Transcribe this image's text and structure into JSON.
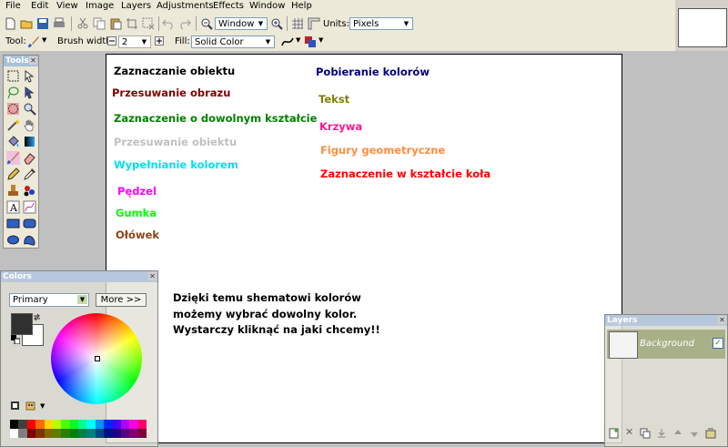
{
  "menu": [
    "File",
    "Edit",
    "View",
    "Image",
    "Layers",
    "Adjustments",
    "Effects",
    "Window",
    "Help"
  ],
  "toolbar": {
    "zoom_value": "Window",
    "units_label": "Units:",
    "units_value": "Pixels",
    "tool_label": "Tool:",
    "brush_label": "Brush width:",
    "brush_value": "2",
    "fill_label": "Fill:",
    "fill_value": "Solid Color"
  },
  "tools_panel": {
    "title": "Tools"
  },
  "canvas": {
    "items": [
      {
        "text": "Zaznaczanie obiektu",
        "color": "#000000"
      },
      {
        "text": "Przesuwanie obrazu",
        "color": "#800000"
      },
      {
        "text": "Zaznaczenie o dowolnym kształcie",
        "color": "#008000"
      },
      {
        "text": "Przesuwanie obiektu",
        "color": "#c0c0c0"
      },
      {
        "text": "Wypełnianie kolorem",
        "color": "#00e0f0"
      },
      {
        "text": "Pędzel",
        "color": "#ff00ff"
      },
      {
        "text": "Gumka",
        "color": "#00ff00"
      },
      {
        "text": "Ołówek",
        "color": "#8b4513"
      },
      {
        "text": "Pobieranie kolorów",
        "color": "#000080"
      },
      {
        "text": "Tekst",
        "color": "#808000"
      },
      {
        "text": "Krzywa",
        "color": "#ff1493"
      },
      {
        "text": "Figury geometryczne",
        "color": "#ff8c40"
      },
      {
        "text": "Zaznaczenie w kształcie koła",
        "color": "#ff0000"
      }
    ],
    "note": [
      "Dzięki temu shematowi kolorów",
      "możemy wybrać dowolny kolor.",
      "Wystarczy kliknąć na jaki chcemy!!"
    ]
  },
  "colors_panel": {
    "title": "Colors",
    "mode": "Primary",
    "more_button": "More >>"
  },
  "layers_panel": {
    "title": "Layers",
    "layer_name": "Background"
  }
}
